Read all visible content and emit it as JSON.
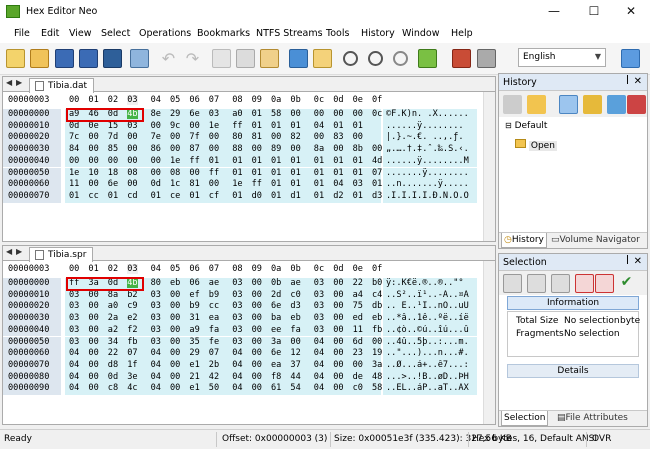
{
  "window": {
    "title": "Hex Editor Neo"
  },
  "menu": [
    "File",
    "Edit",
    "View",
    "Select",
    "Operations",
    "Bookmarks",
    "NTFS Streams",
    "Tools",
    "History",
    "Window",
    "Help"
  ],
  "toolbar": {
    "language": "English"
  },
  "editors": [
    {
      "tab": "Tibia.dat",
      "address": "00000003",
      "columns": [
        "00",
        "01",
        "02",
        "03",
        "04",
        "05",
        "06",
        "07",
        "08",
        "09",
        "0a",
        "0b",
        "0c",
        "0d",
        "0e",
        "0f"
      ],
      "rows": [
        {
          "offset": "00000000",
          "hex": [
            "a9",
            "46",
            "0d",
            "4b",
            "8e",
            "29",
            "6e",
            "03",
            "a0",
            "01",
            "58",
            "00",
            "00",
            "00",
            "00",
            "0c"
          ],
          "ascii": "©F.K)n. .X......"
        },
        {
          "offset": "00000010",
          "hex": [
            "0d",
            "0e",
            "15",
            "03",
            "00",
            "9c",
            "00",
            "1e",
            "ff",
            "01",
            "01",
            "01",
            "04",
            "01",
            "01",
            ""
          ],
          "ascii": "......ÿ........"
        },
        {
          "offset": "00000020",
          "hex": [
            "7c",
            "00",
            "7d",
            "00",
            "7e",
            "00",
            "7f",
            "00",
            "80",
            "81",
            "00",
            "82",
            "00",
            "83",
            "00",
            ""
          ],
          "ascii": "|.}.~.€. ..‚.ƒ."
        },
        {
          "offset": "00000030",
          "hex": [
            "84",
            "00",
            "85",
            "00",
            "86",
            "00",
            "87",
            "00",
            "88",
            "00",
            "89",
            "00",
            "8a",
            "00",
            "8b",
            "00"
          ],
          "ascii": "„.….†.‡.ˆ.‰.Š.‹."
        },
        {
          "offset": "00000040",
          "hex": [
            "00",
            "00",
            "00",
            "00",
            "00",
            "1e",
            "ff",
            "01",
            "01",
            "01",
            "01",
            "01",
            "01",
            "01",
            "01",
            "4d"
          ],
          "ascii": "......ÿ........M"
        },
        {
          "offset": "00000050",
          "hex": [
            "1e",
            "10",
            "18",
            "08",
            "00",
            "08",
            "00",
            "ff",
            "01",
            "01",
            "01",
            "01",
            "01",
            "01",
            "01",
            "07"
          ],
          "ascii": ".......ÿ........"
        },
        {
          "offset": "00000060",
          "hex": [
            "11",
            "00",
            "6e",
            "00",
            "0d",
            "1c",
            "81",
            "00",
            "1e",
            "ff",
            "01",
            "01",
            "01",
            "04",
            "03",
            "01"
          ],
          "ascii": "..n.......ÿ....."
        },
        {
          "offset": "00000070",
          "hex": [
            "01",
            "cc",
            "01",
            "cd",
            "01",
            "ce",
            "01",
            "cf",
            "01",
            "d0",
            "01",
            "d1",
            "01",
            "d2",
            "01",
            "d3"
          ],
          "ascii": ".Ì.Í.Î.Ï.Ð.Ñ.Ò.Ó"
        }
      ]
    },
    {
      "tab": "Tibia.spr",
      "address": "00000003",
      "columns": [
        "00",
        "01",
        "02",
        "03",
        "04",
        "05",
        "06",
        "07",
        "08",
        "09",
        "0a",
        "0b",
        "0c",
        "0d",
        "0e",
        "0f"
      ],
      "rows": [
        {
          "offset": "00000000",
          "hex": [
            "ff",
            "3a",
            "0d",
            "4b",
            "80",
            "eb",
            "06",
            "ae",
            "03",
            "00",
            "0b",
            "ae",
            "03",
            "00",
            "22",
            "b0"
          ],
          "ascii": "ÿ:.K€ë.®..®..\"°"
        },
        {
          "offset": "00000010",
          "hex": [
            "03",
            "00",
            "8a",
            "b2",
            "03",
            "00",
            "ef",
            "b9",
            "03",
            "00",
            "2d",
            "c0",
            "03",
            "00",
            "a4",
            "c4"
          ],
          "ascii": "..Š²..ï¹..-À..¤Ä"
        },
        {
          "offset": "00000020",
          "hex": [
            "03",
            "00",
            "a0",
            "c9",
            "03",
            "00",
            "b9",
            "cc",
            "03",
            "00",
            "6e",
            "d3",
            "03",
            "00",
            "75",
            "db"
          ],
          "ascii": ".. É..¹Ì..nÓ..uÛ"
        },
        {
          "offset": "00000030",
          "hex": [
            "03",
            "00",
            "2a",
            "e2",
            "03",
            "00",
            "31",
            "ea",
            "03",
            "00",
            "ba",
            "eb",
            "03",
            "00",
            "ed",
            "eb"
          ],
          "ascii": "..*â..1ê..ºë..íë"
        },
        {
          "offset": "00000040",
          "hex": [
            "03",
            "00",
            "a2",
            "f2",
            "03",
            "00",
            "a9",
            "fa",
            "03",
            "00",
            "ee",
            "fa",
            "03",
            "00",
            "11",
            "fb"
          ],
          "ascii": "..¢ò..©ú..îú...û"
        },
        {
          "offset": "00000050",
          "hex": [
            "03",
            "00",
            "34",
            "fb",
            "03",
            "00",
            "35",
            "fe",
            "03",
            "00",
            "3a",
            "00",
            "04",
            "00",
            "6d",
            "00"
          ],
          "ascii": "..4û..5þ..:...m."
        },
        {
          "offset": "00000060",
          "hex": [
            "04",
            "00",
            "22",
            "07",
            "04",
            "00",
            "29",
            "07",
            "04",
            "00",
            "6e",
            "12",
            "04",
            "00",
            "23",
            "19"
          ],
          "ascii": "..\"...)...n...#."
        },
        {
          "offset": "00000070",
          "hex": [
            "04",
            "00",
            "d8",
            "1f",
            "04",
            "00",
            "e1",
            "2b",
            "04",
            "00",
            "ea",
            "37",
            "04",
            "00",
            "00",
            "3a"
          ],
          "ascii": "..Ø...á+..ê7...:"
        },
        {
          "offset": "00000080",
          "hex": [
            "04",
            "00",
            "0d",
            "3e",
            "04",
            "00",
            "21",
            "42",
            "04",
            "00",
            "f8",
            "44",
            "04",
            "00",
            "de",
            "48"
          ],
          "ascii": "...>..!B..øD..ÞH"
        },
        {
          "offset": "00000090",
          "hex": [
            "04",
            "00",
            "c8",
            "4c",
            "04",
            "00",
            "e1",
            "50",
            "04",
            "00",
            "61",
            "54",
            "04",
            "00",
            "c0",
            "58"
          ],
          "ascii": "..ÈL..áP..aT..ÀX"
        }
      ]
    }
  ],
  "history": {
    "title": "History",
    "group": "Default",
    "item": "Open",
    "tab1": "History",
    "tab2": "Volume Navigator"
  },
  "selection": {
    "title": "Selection",
    "info": "Information",
    "size_label": "Total Size",
    "size_value": "No selection",
    "size_unit": "byte",
    "frag_label": "Fragments",
    "frag_value": "No selection",
    "details": "Details",
    "tab1": "Selection",
    "tab2": "File Attributes"
  },
  "status": {
    "ready": "Ready",
    "offset": "Offset: 0x00000003 (3)",
    "size": "Size: 0x00051e3f (335.423): 327,56 KB",
    "mode": "Hex bytes, 16, Default ANSI",
    "ovr": "OVR"
  },
  "colors": {
    "selection": "#42b346",
    "hexbg": "#d7f1f6",
    "offsetbg": "#dde6ef",
    "highlight": "#e00000"
  }
}
